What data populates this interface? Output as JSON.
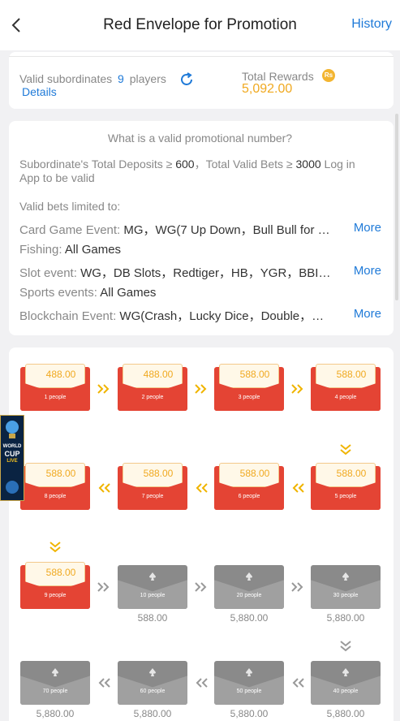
{
  "header": {
    "title": "Red Envelope for Promotion",
    "history_label": "History"
  },
  "summary": {
    "valid_label": "Valid subordinates",
    "valid_count": "9",
    "players_label": "players",
    "details_label": "Details",
    "total_rewards_label": "Total Rewards",
    "currency_badge": "Rs",
    "total_rewards_value": "5,092.00"
  },
  "rules": {
    "question": "What is a valid promotional number?",
    "rule_a": "Subordinate's Total Deposits ≥ ",
    "deposit_value": "600",
    "rule_b": "，Total Valid Bets ≥ ",
    "bet_value": "3000",
    "rule_c": " Log in App to be valid",
    "limited_label": "Valid bets limited to:",
    "items": [
      {
        "label": "Card Game Event:",
        "value": "MG，WG(7 Up Down，Bull Bull for …",
        "more": "More"
      },
      {
        "label": "Fishing:",
        "value": "All Games",
        "more": ""
      },
      {
        "label": "Slot event:",
        "value": "WG，DB Slots，Redtiger，HB，YGR，BBI…",
        "more": "More"
      },
      {
        "label": "Sports events:",
        "value": "All Games",
        "more": ""
      },
      {
        "label": "Blockchain Event:",
        "value": "WG(Crash，Lucky Dice，Double，…",
        "more": "More"
      }
    ]
  },
  "envelopes": [
    {
      "amount": "488.00",
      "people": "1 people",
      "state": "open"
    },
    {
      "amount": "488.00",
      "people": "2 people",
      "state": "open"
    },
    {
      "amount": "588.00",
      "people": "3 people",
      "state": "open"
    },
    {
      "amount": "588.00",
      "people": "4 people",
      "state": "open"
    },
    {
      "amount": "588.00",
      "people": "5 people",
      "state": "open"
    },
    {
      "amount": "588.00",
      "people": "6 people",
      "state": "open"
    },
    {
      "amount": "588.00",
      "people": "7 people",
      "state": "open"
    },
    {
      "amount": "588.00",
      "people": "8 people",
      "state": "open"
    },
    {
      "amount": "588.00",
      "people": "9 people",
      "state": "open"
    },
    {
      "amount": "588.00",
      "people": "10 people",
      "state": "locked"
    },
    {
      "amount": "5,880.00",
      "people": "20 people",
      "state": "locked"
    },
    {
      "amount": "5,880.00",
      "people": "30 people",
      "state": "locked"
    },
    {
      "amount": "5,880.00",
      "people": "40 people",
      "state": "locked"
    },
    {
      "amount": "5,880.00",
      "people": "50 people",
      "state": "locked"
    },
    {
      "amount": "5,880.00",
      "people": "60 people",
      "state": "locked"
    },
    {
      "amount": "5,880.00",
      "people": "70 people",
      "state": "locked"
    }
  ],
  "side_ad": {
    "line1": "WORLD",
    "line2": "CUP",
    "line3": "LIVE"
  },
  "colors": {
    "accent": "#1f7ad8",
    "red": "#e44434",
    "gold": "#f0a920",
    "locked": "#8a8a8a"
  }
}
